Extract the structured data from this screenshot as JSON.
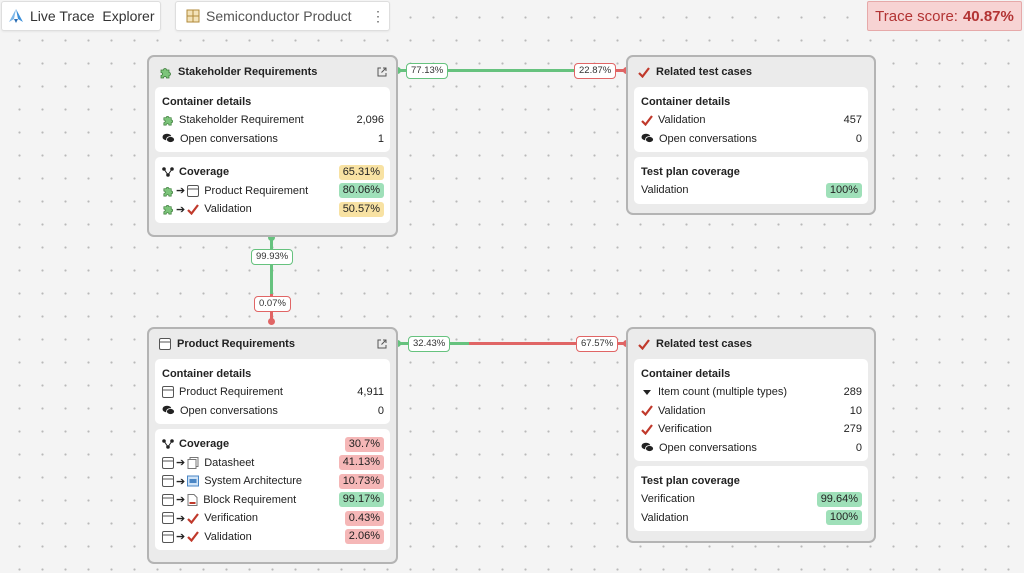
{
  "app": {
    "title": "Live Trace  Explorer",
    "icon": "logo-icon"
  },
  "project": {
    "title": "Semiconductor Product",
    "menu_icon": "kebab-icon"
  },
  "trace_score": {
    "label": "Trace score:",
    "value": "40.87%"
  },
  "connectors": {
    "top_h_left": "77.13%",
    "top_h_right": "22.87%",
    "v_top": "99.93%",
    "v_bottom": "0.07%",
    "bottom_h_left": "32.43%",
    "bottom_h_right": "67.57%"
  },
  "stakeholder_card": {
    "title": "Stakeholder Requirements",
    "details_title": "Container details",
    "details": [
      {
        "label": "Stakeholder Requirement",
        "value": "2,096",
        "icon": "puzzle-icon"
      },
      {
        "label": "Open conversations",
        "value": "1",
        "icon": "chat-icon"
      }
    ],
    "coverage_title": "Coverage",
    "coverage_value": "65.31%",
    "coverage": [
      {
        "label": "Product Requirement",
        "value": "80.06%",
        "from_icon": "puzzle-icon",
        "to_icon": "table-icon"
      },
      {
        "label": "Validation",
        "value": "50.57%",
        "from_icon": "puzzle-icon",
        "to_icon": "check-icon"
      }
    ]
  },
  "related_top_card": {
    "title": "Related test cases",
    "details_title": "Container details",
    "details": [
      {
        "label": "Validation",
        "value": "457",
        "icon": "check-icon"
      },
      {
        "label": "Open conversations",
        "value": "0",
        "icon": "chat-icon"
      }
    ],
    "plan_title": "Test plan coverage",
    "plan": [
      {
        "label": "Validation",
        "value": "100%"
      }
    ]
  },
  "product_card": {
    "title": "Product Requirements",
    "details_title": "Container details",
    "details": [
      {
        "label": "Product Requirement",
        "value": "4,911",
        "icon": "table-icon"
      },
      {
        "label": "Open conversations",
        "value": "0",
        "icon": "chat-icon"
      }
    ],
    "coverage_title": "Coverage",
    "coverage_value": "30.7%",
    "coverage": [
      {
        "label": "Datasheet",
        "value": "41.13%",
        "from_icon": "table-icon",
        "to_icon": "docs-icon"
      },
      {
        "label": "System Architecture",
        "value": "10.73%",
        "from_icon": "table-icon",
        "to_icon": "architecture-icon"
      },
      {
        "label": "Block Requirement",
        "value": "99.17%",
        "from_icon": "table-icon",
        "to_icon": "block-doc-icon"
      },
      {
        "label": "Verification",
        "value": "0.43%",
        "from_icon": "table-icon",
        "to_icon": "check-icon"
      },
      {
        "label": "Validation",
        "value": "2.06%",
        "from_icon": "table-icon",
        "to_icon": "check-icon"
      }
    ]
  },
  "related_bottom_card": {
    "title": "Related test cases",
    "details_title": "Container details",
    "details": [
      {
        "label": "Item count (multiple types)",
        "value": "289",
        "icon": "caret-down-icon"
      },
      {
        "label": "Validation",
        "value": "10",
        "icon": "check-icon"
      },
      {
        "label": "Verification",
        "value": "279",
        "icon": "check-icon"
      },
      {
        "label": "Open conversations",
        "value": "0",
        "icon": "chat-icon"
      }
    ],
    "plan_title": "Test plan coverage",
    "plan": [
      {
        "label": "Verification",
        "value": "99.64%"
      },
      {
        "label": "Validation",
        "value": "100%"
      }
    ]
  }
}
